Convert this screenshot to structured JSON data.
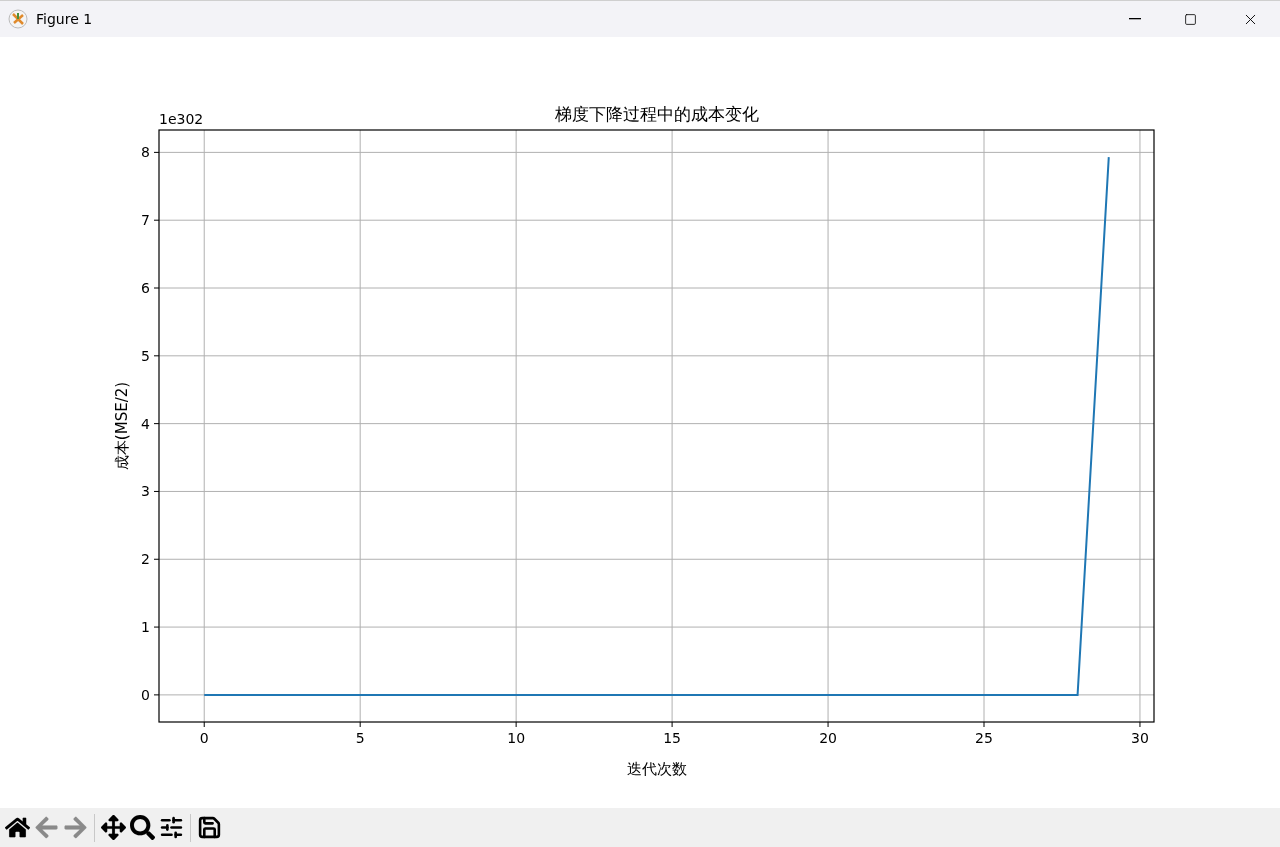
{
  "window": {
    "title": "Figure 1"
  },
  "figure": {
    "chart_data": {
      "type": "line",
      "title": "梯度下降过程中的成本变化",
      "xlabel": "迭代次数",
      "ylabel": "成本(MSE/2)",
      "annotations": [
        {
          "text": "1e302"
        }
      ],
      "x": [
        0,
        1,
        2,
        3,
        4,
        5,
        6,
        7,
        8,
        9,
        10,
        11,
        12,
        13,
        14,
        15,
        16,
        17,
        18,
        19,
        20,
        21,
        22,
        23,
        24,
        25,
        26,
        27,
        28,
        29
      ],
      "series": [
        {
          "color": "#1f77b4",
          "values": [
            0,
            0,
            0,
            0,
            0,
            0,
            0,
            0,
            0,
            0,
            0,
            0,
            0,
            0,
            0,
            0,
            0,
            0,
            0,
            0,
            0,
            0,
            0,
            0,
            0,
            0,
            0,
            0,
            0,
            7.93
          ]
        }
      ],
      "xlim": [
        -1.45,
        30.45
      ],
      "ylim": [
        -0.4,
        8.33
      ],
      "xticks": [
        0,
        5,
        10,
        15,
        20,
        25,
        30
      ],
      "yticks": [
        0,
        1,
        2,
        3,
        4,
        5,
        6,
        7,
        8
      ],
      "grid": true
    }
  },
  "toolbar": {
    "groups": [
      [
        {
          "kind": "home",
          "disabled": false
        },
        {
          "kind": "back",
          "disabled": true
        },
        {
          "kind": "forward",
          "disabled": true
        }
      ],
      [
        {
          "kind": "pan",
          "disabled": false
        },
        {
          "kind": "zoom",
          "disabled": false
        },
        {
          "kind": "configure",
          "disabled": false
        }
      ],
      [
        {
          "kind": "save",
          "disabled": false
        }
      ]
    ]
  }
}
